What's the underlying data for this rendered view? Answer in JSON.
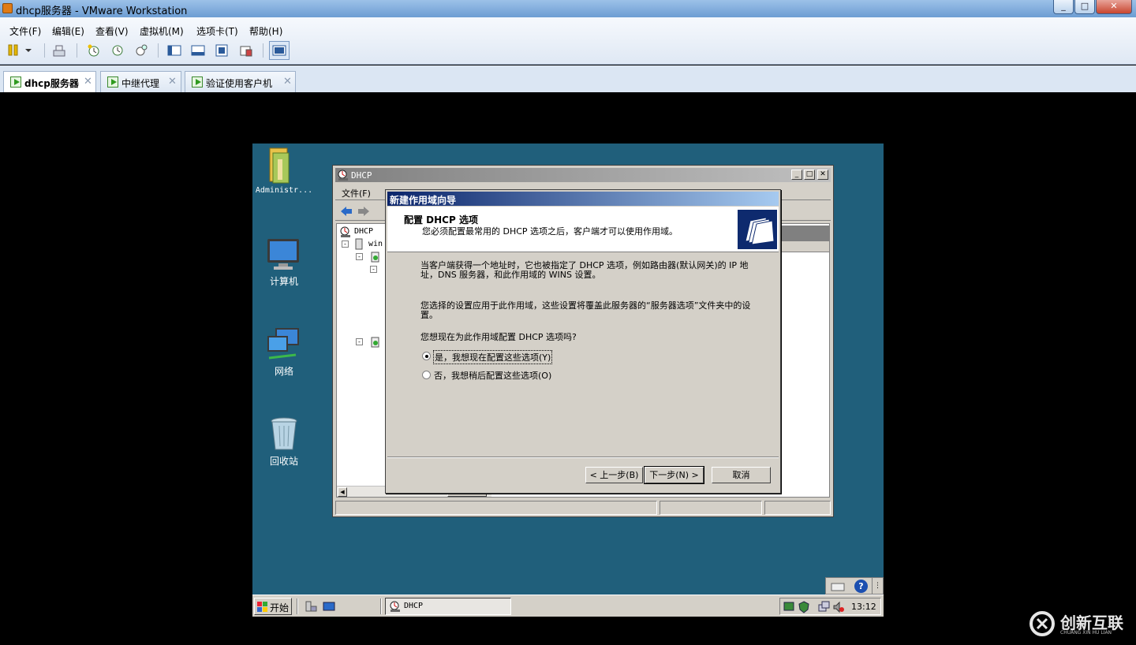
{
  "vmware": {
    "title": "dhcp服务器 - VMware Workstation",
    "menu": [
      "文件(F)",
      "编辑(E)",
      "查看(V)",
      "虚拟机(M)",
      "选项卡(T)",
      "帮助(H)"
    ],
    "tabs": [
      {
        "label": "dhcp服务器",
        "active": true
      },
      {
        "label": "中继代理",
        "active": false
      },
      {
        "label": "验证使用客户机",
        "active": false
      }
    ],
    "window_controls": {
      "minimize": "_",
      "maximize": "□",
      "close": "✕"
    },
    "tab_close": "✕"
  },
  "desktop": {
    "icons": [
      {
        "label": "Administr...",
        "icon": "folder-icon"
      },
      {
        "label": "计算机",
        "icon": "computer-icon"
      },
      {
        "label": "网络",
        "icon": "network-icon"
      },
      {
        "label": "回收站",
        "icon": "recycle-bin-icon"
      }
    ],
    "background": "#205f7b"
  },
  "dhcp_window": {
    "title": "DHCP",
    "menu_visible": "文件(F)",
    "tree_root": "DHCP",
    "tree_server": "win"
  },
  "wizard": {
    "title": "新建作用域向导",
    "header_title": "配置 DHCP 选项",
    "header_subtitle": "您必须配置最常用的 DHCP 选项之后，客户端才可以使用作用域。",
    "para1": "当客户端获得一个地址时，它也被指定了 DHCP 选项，例如路由器(默认网关)的 IP 地址，DNS 服务器，和此作用域的 WINS 设置。",
    "para2": "您选择的设置应用于此作用域，这些设置将覆盖此服务器的“服务器选项”文件夹中的设置。",
    "question": "您想现在为此作用域配置 DHCP 选项吗?",
    "option_yes": "是，我想现在配置这些选项(Y)",
    "option_no": "否，我想稍后配置这些选项(O)",
    "selected": "yes",
    "back": "< 上一步(B)",
    "next": "下一步(N) >",
    "cancel": "取消"
  },
  "taskbar": {
    "start": "开始",
    "task": "DHCP",
    "clock": "13:12",
    "help": "?"
  },
  "watermark": {
    "text": "创新互联",
    "sub": "CHUANG XIN HU LIAN"
  },
  "colors": {
    "accent": "#0a246a",
    "desktop": "#205f7b"
  }
}
